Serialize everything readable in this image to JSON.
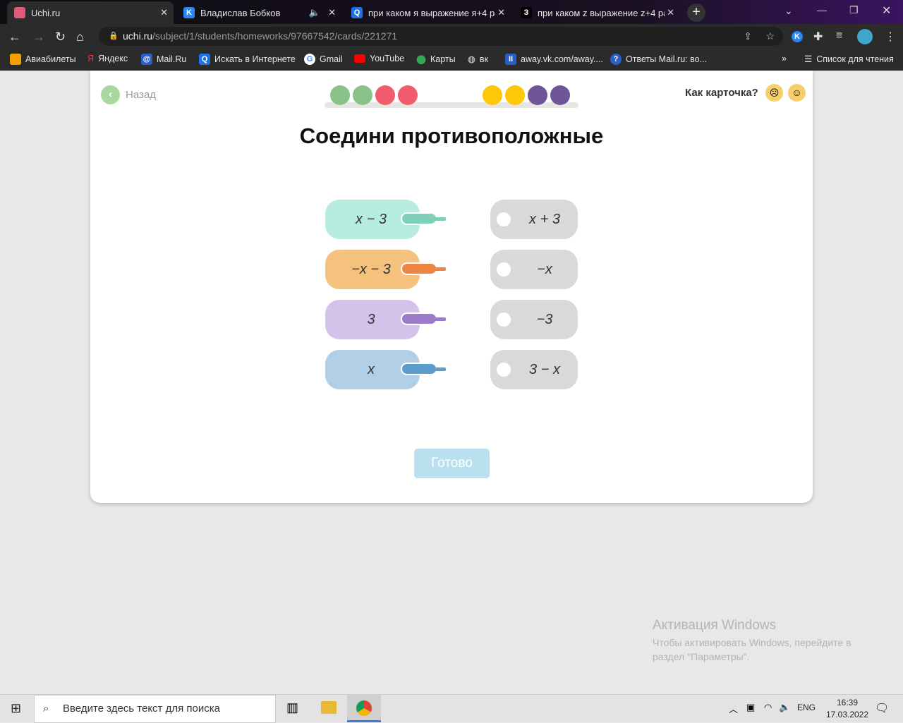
{
  "browser": {
    "tabs": [
      {
        "title": "Uchi.ru",
        "active": true
      },
      {
        "title": "Владислав Бобков"
      },
      {
        "title": "при каком я выражение я+4 ра"
      },
      {
        "title": "при каком z выражение z+4 ра"
      }
    ],
    "url_host": "uchi.ru",
    "url_path": "/subject/1/students/homeworks/97667542/cards/221271",
    "bookmarks": [
      "Авиабилеты",
      "Яндекс",
      "Mail.Ru",
      "Искать в Интернете",
      "Gmail",
      "YouTube",
      "Карты",
      "вк",
      "away.vk.com/away....",
      "Ответы Mail.ru: во..."
    ],
    "reading_list": "Список для чтения"
  },
  "page": {
    "back_label": "Назад",
    "rate_label": "Как карточка?",
    "title": "Соедини противоположные",
    "progress_dots": [
      "#8bc28a",
      "#8bc28a",
      "#f15b6c",
      "#f15b6c",
      null,
      null,
      "#fec70a",
      "#fec70a",
      "#6e5596",
      "#6e5596"
    ],
    "left": [
      {
        "text": "x − 3",
        "color": "#b7ece0",
        "handle": "#7fcfb9"
      },
      {
        "text": "−x − 3",
        "color": "#f5c27e",
        "handle": "#eb8541"
      },
      {
        "text": "3",
        "color": "#d5c2ea",
        "handle": "#9b7cc9"
      },
      {
        "text": "x",
        "color": "#b1cfe6",
        "handle": "#5a9ccc"
      }
    ],
    "right": [
      "x + 3",
      "−x",
      "−3",
      "3 − x"
    ],
    "done_label": "Готово"
  },
  "os": {
    "activation_title": "Активация Windows",
    "activation_text1": "Чтобы активировать Windows, перейдите в",
    "activation_text2": "раздел \"Параметры\".",
    "search_placeholder": "Введите здесь текст для поиска",
    "lang": "ENG",
    "time": "16:39",
    "date": "17.03.2022"
  }
}
